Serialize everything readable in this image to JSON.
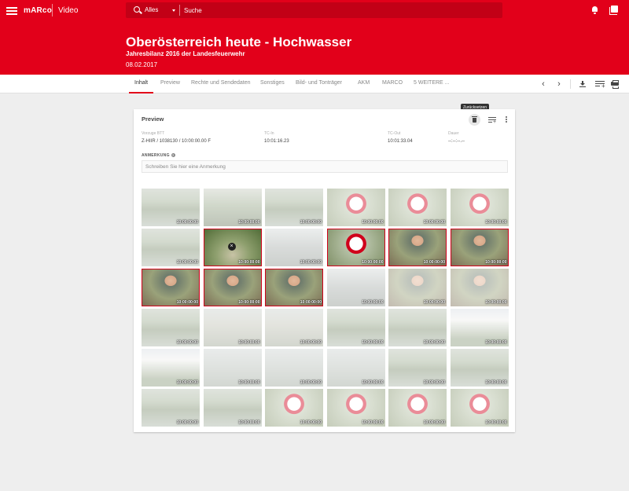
{
  "header": {
    "brand": "mARco",
    "section": "Video",
    "search_scope": "Alles",
    "search_placeholder": "Suche",
    "title": "Oberösterreich heute - Hochwasser",
    "subtitle": "Jahresbilanz 2016 der Landesfeuerwehr",
    "date": "08.02.2017",
    "accent_color": "#e2001a"
  },
  "tabs": [
    {
      "label": "Inhalt",
      "active": true
    },
    {
      "label": "Preview"
    },
    {
      "label": "Rechte und Sendedaten"
    },
    {
      "label": "Sonstiges"
    },
    {
      "label": "Bild- und Tonträger"
    },
    {
      "label": "AKM"
    },
    {
      "label": "MARCO"
    },
    {
      "label": "5 WEITERE ..."
    }
  ],
  "toolbar_icons": [
    "chevron-left-icon",
    "chevron-right-icon",
    "download-icon",
    "playlist-add-icon",
    "print-icon"
  ],
  "preview": {
    "title": "Preview",
    "tooltip": "Zurücksetzen",
    "fields": [
      {
        "label": "Vorzuge BTT",
        "value": "Z-HIIR / 1038130 / 10:00:00.00 F"
      },
      {
        "label": "TC-In",
        "value": "10:01:16.23"
      },
      {
        "label": "TC-Out",
        "value": "10:01:33.04"
      },
      {
        "label": "Dauer",
        "value": "--:--:--.--"
      }
    ],
    "annotation_label": "ANMERKUNG",
    "annotation_placeholder": "Schreiben Sie hier eine Anmerkung"
  },
  "thumbnails": [
    {
      "tc": "10:00:00:00",
      "scene": "water",
      "state": "dim"
    },
    {
      "tc": "10:00:00:00",
      "scene": "stairs",
      "state": "dim"
    },
    {
      "tc": "10:00:00:00",
      "scene": "water",
      "state": "dim"
    },
    {
      "tc": "10:00:00:00",
      "scene": "sign",
      "state": "dim"
    },
    {
      "tc": "10:00:00:00",
      "scene": "sign",
      "state": "dim"
    },
    {
      "tc": "10:00:00:00",
      "scene": "sign",
      "state": "dim"
    },
    {
      "tc": "10:00:00:00",
      "scene": "water",
      "state": "dim"
    },
    {
      "tc": "10:00:00:00",
      "scene": "path",
      "state": "selected",
      "marker": "close"
    },
    {
      "tc": "10:00:00:00",
      "scene": "road",
      "state": "dim"
    },
    {
      "tc": "10:00:00:00",
      "scene": "sign",
      "state": "selected"
    },
    {
      "tc": "10:00:00:00",
      "scene": "man",
      "state": "selected"
    },
    {
      "tc": "10:00:00:00",
      "scene": "man",
      "state": "selected"
    },
    {
      "tc": "10:00:00:00",
      "scene": "man",
      "state": "selected"
    },
    {
      "tc": "10:00:00:00",
      "scene": "man",
      "state": "selected"
    },
    {
      "tc": "10:00:00:00",
      "scene": "man",
      "state": "selected"
    },
    {
      "tc": "10:00:00:00",
      "scene": "road",
      "state": "dim"
    },
    {
      "tc": "10:00:00:00",
      "scene": "man",
      "state": "dim"
    },
    {
      "tc": "10:00:00:00",
      "scene": "man",
      "state": "dim"
    },
    {
      "tc": "10:00:00:00",
      "scene": "water",
      "state": "dim"
    },
    {
      "tc": "10:00:00:00",
      "scene": "flood",
      "state": "dim"
    },
    {
      "tc": "10:00:00:00",
      "scene": "flood",
      "state": "dim"
    },
    {
      "tc": "10:00:00:00",
      "scene": "water",
      "state": "dim"
    },
    {
      "tc": "10:00:00:00",
      "scene": "water",
      "state": "dim"
    },
    {
      "tc": "10:00:00:00",
      "scene": "house",
      "state": "dim"
    },
    {
      "tc": "10:00:00:00",
      "scene": "house",
      "state": "dim"
    },
    {
      "tc": "10:00:00:00",
      "scene": "fog",
      "state": "dim"
    },
    {
      "tc": "10:00:00:00",
      "scene": "fog",
      "state": "dim"
    },
    {
      "tc": "10:00:00:00",
      "scene": "fog",
      "state": "dim"
    },
    {
      "tc": "10:00:00:00",
      "scene": "water",
      "state": "dim"
    },
    {
      "tc": "10:00:00:00",
      "scene": "water",
      "state": "dim"
    },
    {
      "tc": "10:00:00:00",
      "scene": "water",
      "state": "dim"
    },
    {
      "tc": "10:00:00:00",
      "scene": "water",
      "state": "dim"
    },
    {
      "tc": "10:00:00:00",
      "scene": "sign",
      "state": "dim"
    },
    {
      "tc": "10:00:00:00",
      "scene": "sign",
      "state": "dim"
    },
    {
      "tc": "10:00:00:00",
      "scene": "sign",
      "state": "dim"
    },
    {
      "tc": "10:00:00:00",
      "scene": "sign",
      "state": "dim"
    }
  ]
}
